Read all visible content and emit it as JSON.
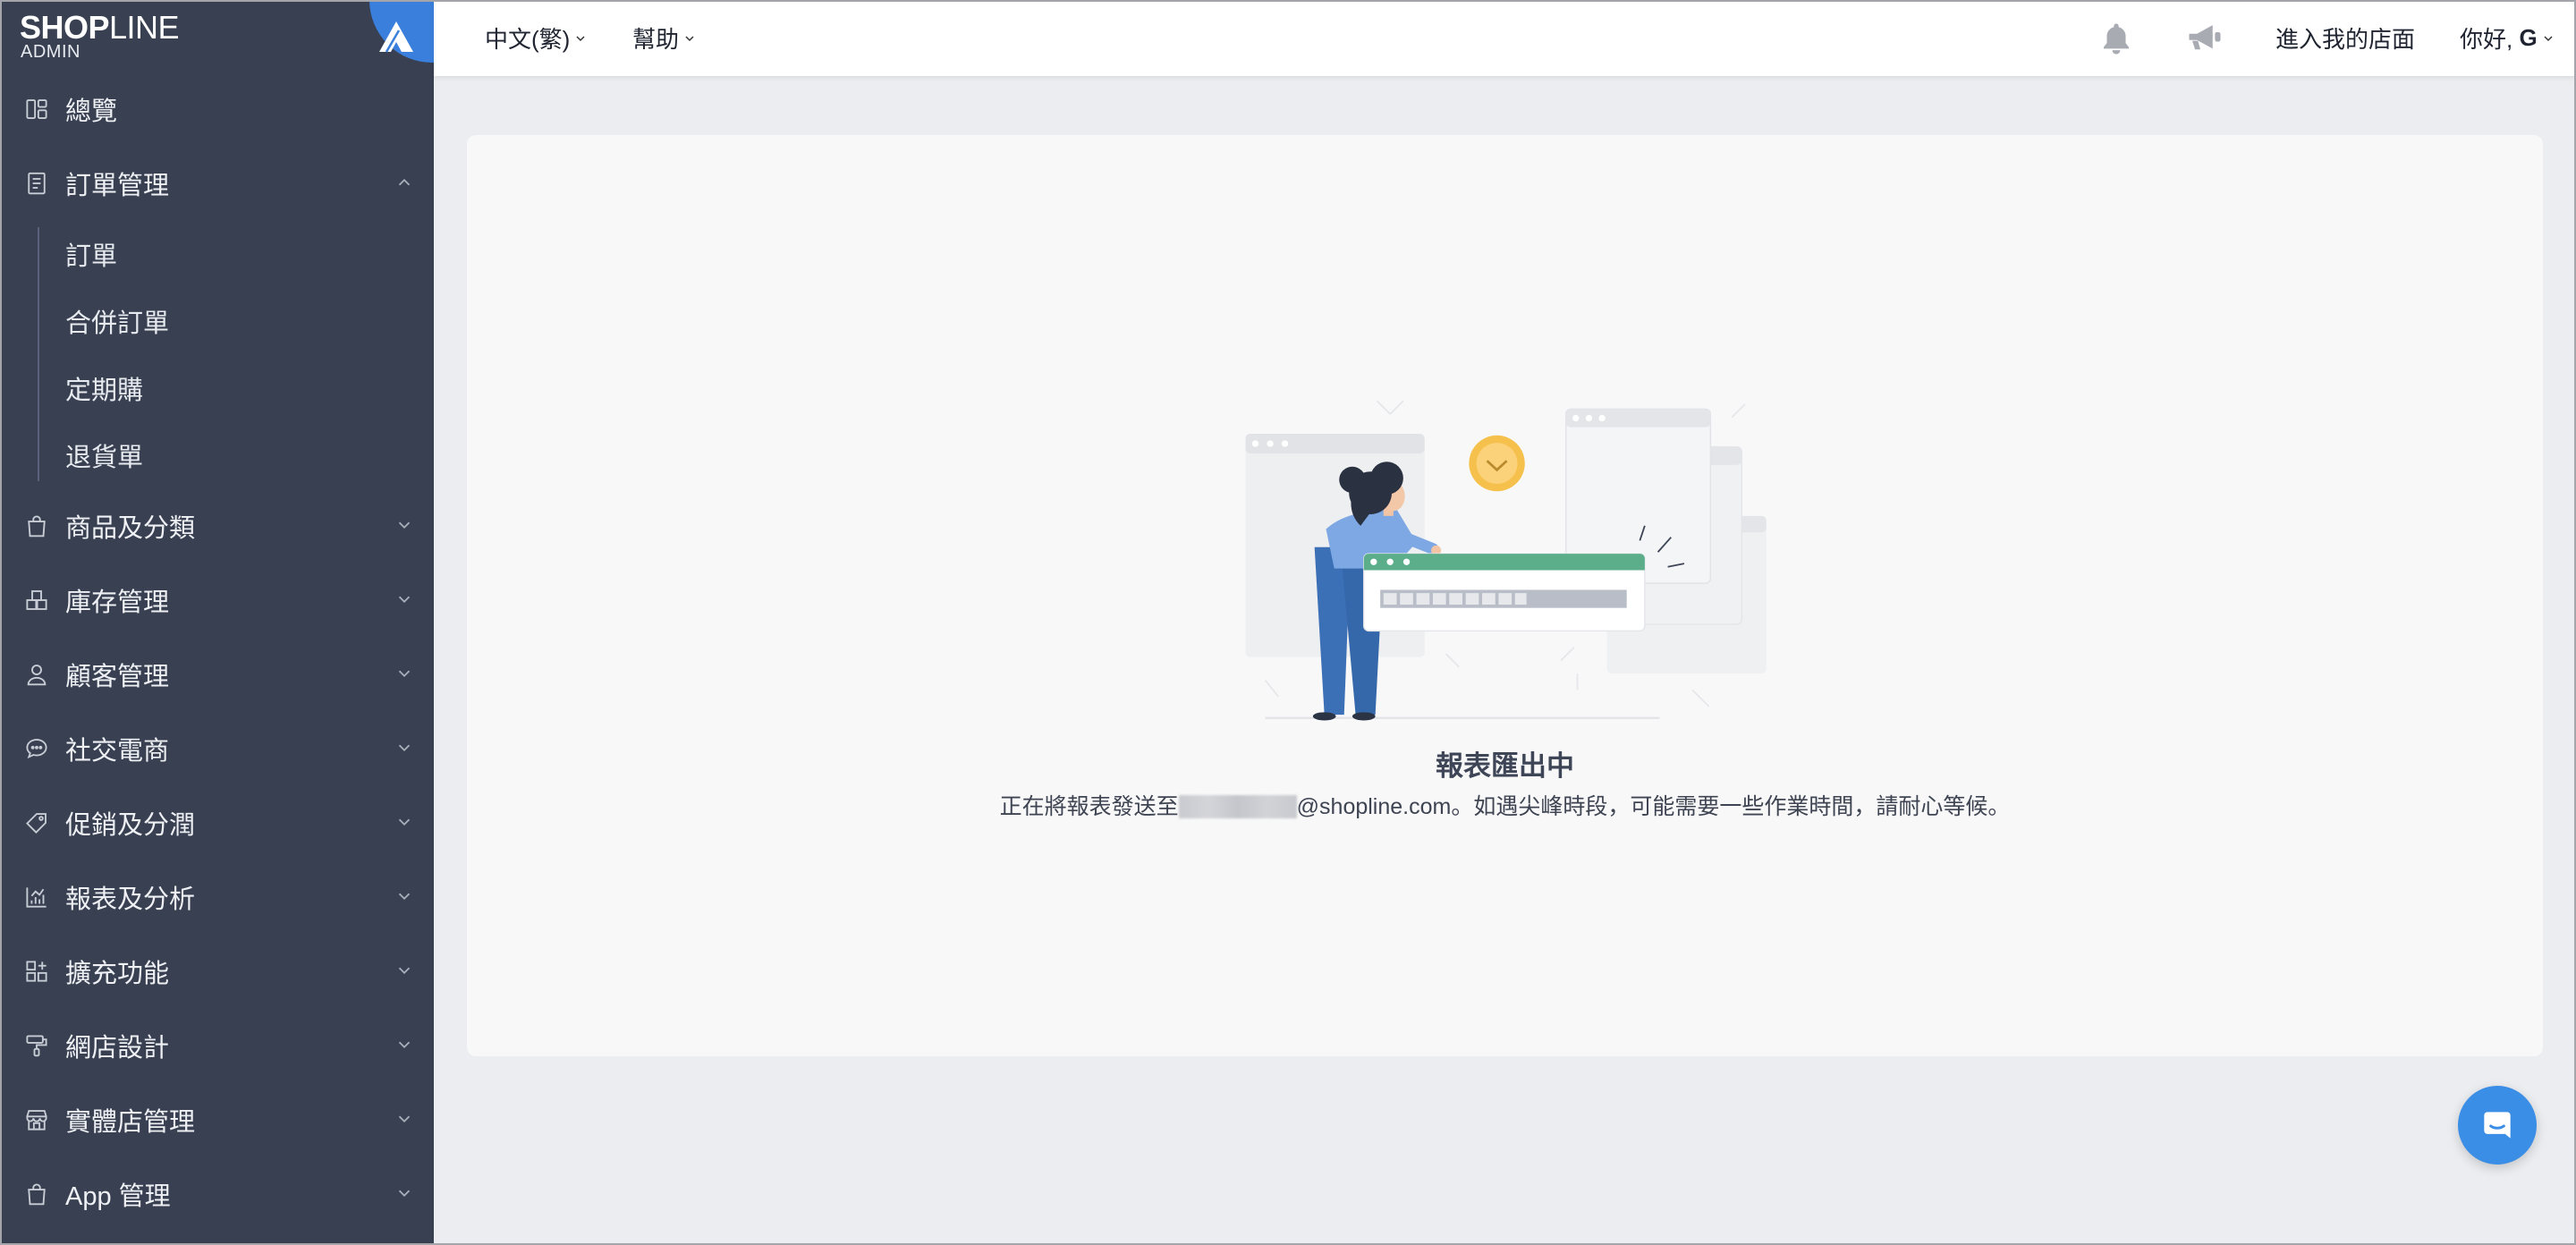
{
  "app": {
    "brand_bold": "SHOP",
    "brand_light": "LINE",
    "brand_sub": "ADMIN",
    "logo_icon": "shopline-logo-icon"
  },
  "header": {
    "language": "中文(繁)",
    "help": "幫助",
    "notification_icon": "bell-icon",
    "announcement_icon": "megaphone-icon",
    "storefront": "進入我的店面",
    "greeting": "你好, ",
    "user": "G"
  },
  "sidebar": {
    "items": [
      {
        "label": "總覽",
        "icon": "dashboard-icon"
      },
      {
        "label": "訂單管理",
        "icon": "order-icon",
        "expanded": true,
        "children": [
          "訂單",
          "合併訂單",
          "定期購",
          "退貨單"
        ]
      },
      {
        "label": "商品及分類",
        "icon": "bag-icon"
      },
      {
        "label": "庫存管理",
        "icon": "inventory-icon"
      },
      {
        "label": "顧客管理",
        "icon": "customer-icon"
      },
      {
        "label": "社交電商",
        "icon": "chat-icon"
      },
      {
        "label": "促銷及分潤",
        "icon": "tag-icon"
      },
      {
        "label": "報表及分析",
        "icon": "report-chart-icon"
      },
      {
        "label": "擴充功能",
        "icon": "apps-icon"
      },
      {
        "label": "網店設計",
        "icon": "paint-roller-icon"
      },
      {
        "label": "實體店管理",
        "icon": "store-icon"
      },
      {
        "label": "App 管理",
        "icon": "app-bag-icon"
      }
    ]
  },
  "main": {
    "title": "報表匯出中",
    "message_prefix": "正在將報表發送至",
    "message_suffix": "@shopline.com。如遇尖峰時段，可能需要一些作業時間，請耐心等候。"
  },
  "chat": {
    "icon": "chat-bubble-icon"
  },
  "colors": {
    "sidebar_bg": "#384052",
    "page_bg": "#ecedf0",
    "brand_blue": "#3a7fdc",
    "chat_blue": "#3a8ee6",
    "progress_header_green": "#5cae8b",
    "clock_yellow": "#f5c14c"
  }
}
